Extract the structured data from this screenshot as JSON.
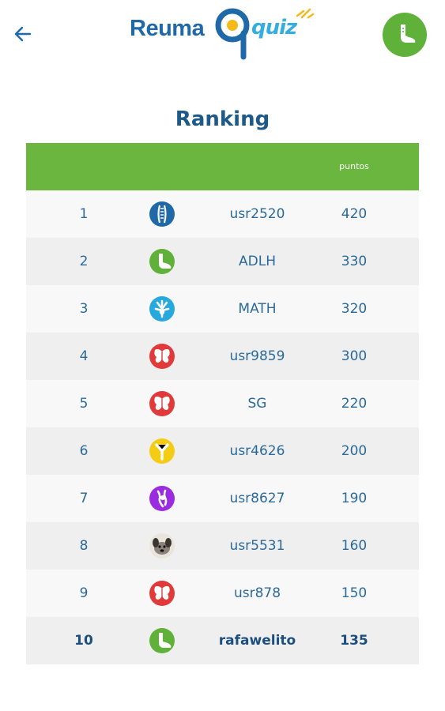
{
  "header": {
    "logo_word": "Reuma",
    "logo_quiz": "quiz"
  },
  "page": {
    "title": "Ranking"
  },
  "table": {
    "columns": {
      "rank": "",
      "avatar": "",
      "name": "",
      "points": "puntos"
    },
    "rows": [
      {
        "rank": "1",
        "name": "usr2520",
        "points": "420",
        "avatar_icon": "spine-icon",
        "avatar_color": "#1f69a8"
      },
      {
        "rank": "2",
        "name": "ADLH",
        "points": "330",
        "avatar_icon": "foot-icon",
        "avatar_color": "#5fb13a"
      },
      {
        "rank": "3",
        "name": "MATH",
        "points": "320",
        "avatar_icon": "hand-bones-icon",
        "avatar_color": "#27a9de"
      },
      {
        "rank": "4",
        "name": "usr9859",
        "points": "300",
        "avatar_icon": "butterfly-icon",
        "avatar_color": "#e23a3a"
      },
      {
        "rank": "5",
        "name": "SG",
        "points": "220",
        "avatar_icon": "butterfly-icon",
        "avatar_color": "#e23a3a"
      },
      {
        "rank": "6",
        "name": "usr4626",
        "points": "200",
        "avatar_icon": "y-joint-icon",
        "avatar_color": "#f5cc14"
      },
      {
        "rank": "7",
        "name": "usr8627",
        "points": "190",
        "avatar_icon": "knee-icon",
        "avatar_color": "#9b2be0"
      },
      {
        "rank": "8",
        "name": "usr5531",
        "points": "160",
        "avatar_icon": "dog-photo-avatar",
        "avatar_color": "#8a8278"
      },
      {
        "rank": "9",
        "name": "usr878",
        "points": "150",
        "avatar_icon": "butterfly-icon",
        "avatar_color": "#e23a3a"
      },
      {
        "rank": "10",
        "name": "rafawelito",
        "points": "135",
        "avatar_icon": "foot-icon",
        "avatar_color": "#5fb13a",
        "current_user": true
      }
    ]
  },
  "colors": {
    "header_green": "#6ab63f",
    "title_blue": "#1d5a8a"
  }
}
